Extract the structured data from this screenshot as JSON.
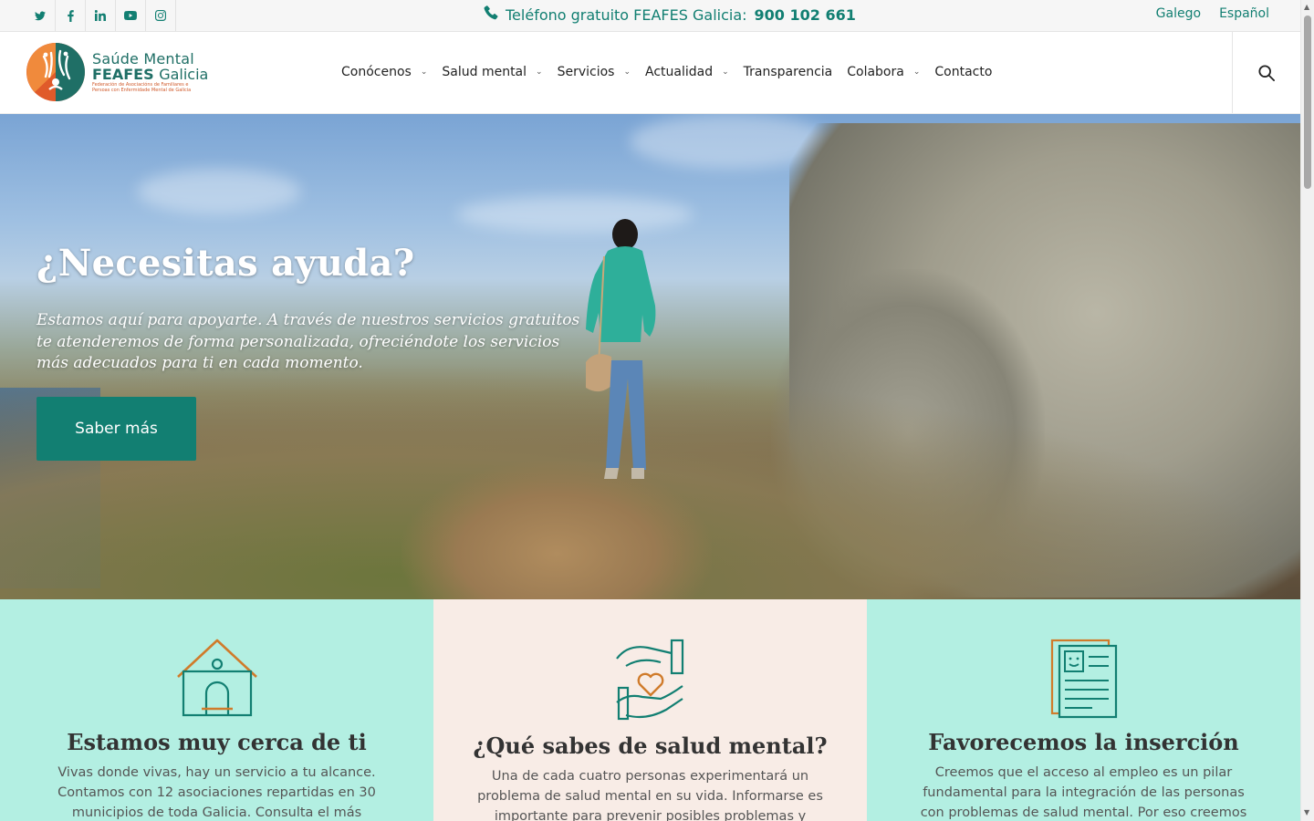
{
  "topbar": {
    "social": [
      "twitter-icon",
      "facebook-icon",
      "linkedin-icon",
      "youtube-icon",
      "instagram-icon"
    ],
    "phone_label": "Teléfono gratuito FEAFES Galicia:",
    "phone_number": "900 102 661",
    "languages": [
      "Galego",
      "Español"
    ]
  },
  "header": {
    "logo": {
      "line1": "Saúde Mental",
      "line2a": "FEAFES",
      "line2b": "Galicia",
      "subtitle": "Federación de Asociacións de Familiares e Persoas con Enfermidade Mental de Galicia"
    },
    "nav": [
      {
        "label": "Conócenos",
        "has_dropdown": true
      },
      {
        "label": "Salud mental",
        "has_dropdown": true
      },
      {
        "label": "Servicios",
        "has_dropdown": true
      },
      {
        "label": "Actualidad",
        "has_dropdown": true
      },
      {
        "label": "Transparencia",
        "has_dropdown": false
      },
      {
        "label": "Colabora",
        "has_dropdown": true
      },
      {
        "label": "Contacto",
        "has_dropdown": false
      }
    ],
    "search_icon": "search-icon"
  },
  "hero": {
    "title": "¿Necesitas ayuda?",
    "text": "Estamos aquí para apoyarte. A través de nuestros servicios gratuitos te atenderemos de forma personalizada, ofreciéndote los servicios más adecuados para ti en cada momento.",
    "button": "Saber más"
  },
  "features": [
    {
      "icon": "house-icon",
      "title": "Estamos muy cerca de ti",
      "text": "Vivas donde vivas, hay un servicio a tu alcance. Contamos con 12 asociaciones repartidas en 30 municipios de toda Galicia. Consulta el más cercano a"
    },
    {
      "icon": "hands-heart-icon",
      "title": "¿Qué sabes de salud mental?",
      "text": "Una de cada cuatro personas experimentará un problema de salud mental en su vida. Informarse es importante para prevenir posibles problemas y"
    },
    {
      "icon": "resume-document-icon",
      "title": "Favorecemos la inserción",
      "text": "Creemos que el acceso al empleo es un pilar fundamental para la integración de las personas con problemas de salud mental. Por eso creemos"
    }
  ],
  "colors": {
    "accent": "#127f72",
    "mint": "#b3efe2",
    "peach": "#f8ece6"
  }
}
